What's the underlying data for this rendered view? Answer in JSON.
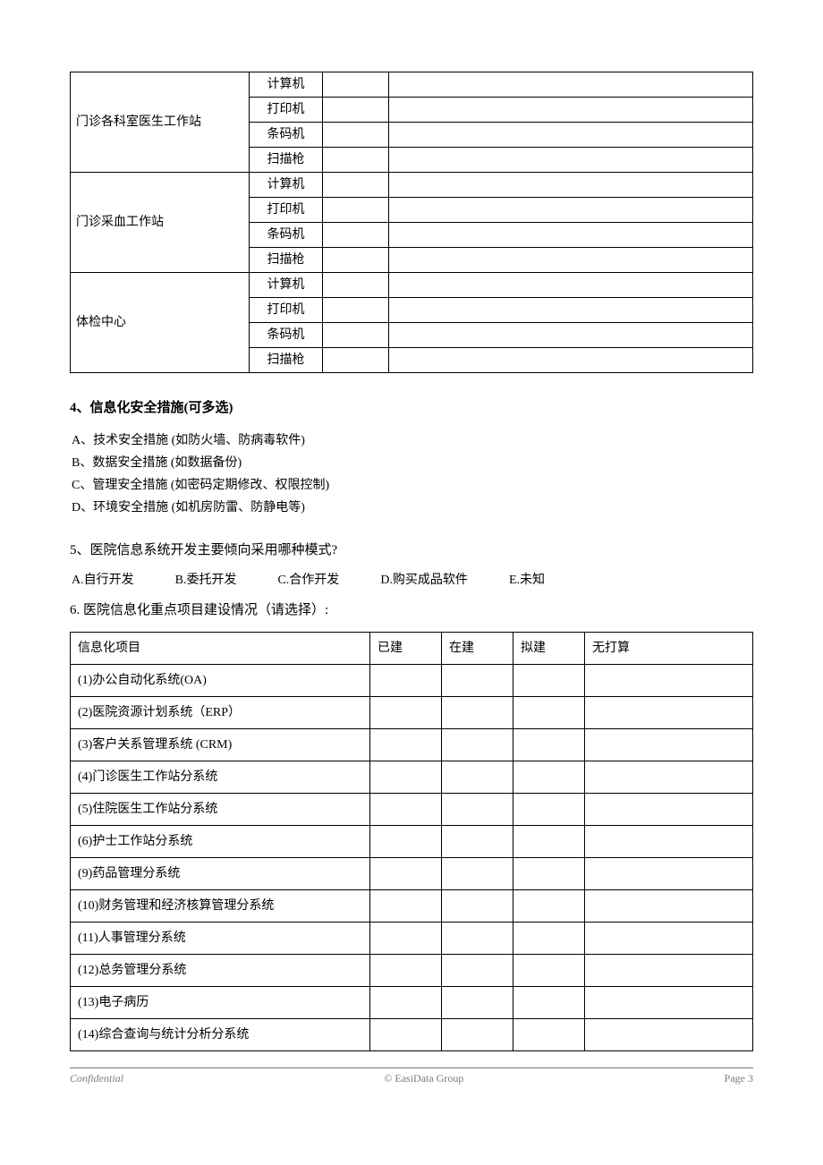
{
  "table1": {
    "groups": [
      {
        "label": "门诊各科室医生工作站",
        "rows": [
          "计算机",
          "打印机",
          "条码机",
          "扫描枪"
        ]
      },
      {
        "label": "门诊采血工作站",
        "rows": [
          "计算机",
          "打印机",
          "条码机",
          "扫描枪"
        ]
      },
      {
        "label": "体检中心",
        "rows": [
          "计算机",
          "打印机",
          "条码机",
          "扫描枪"
        ]
      }
    ]
  },
  "q4": {
    "heading": "4、信息化安全措施(可多选)",
    "options": [
      "A、技术安全措施 (如防火墙、防病毒软件)",
      "B、数据安全措施 (如数据备份)",
      "C、管理安全措施 (如密码定期修改、权限控制)",
      "D、环境安全措施 (如机房防雷、防静电等)"
    ]
  },
  "q5": {
    "heading": "5、医院信息系统开发主要倾向采用哪种模式?",
    "options": [
      "A.自行开发",
      "B.委托开发",
      "C.合作开发",
      "D.购买成品软件",
      "E.未知"
    ]
  },
  "q6": {
    "heading": "6. 医院信息化重点项目建设情况（请选择）:",
    "headers": [
      "信息化项目",
      "已建",
      "在建",
      "拟建",
      "无打算"
    ],
    "rows": [
      "(1)办公自动化系统(OA)",
      "(2)医院资源计划系统（ERP）",
      "(3)客户关系管理系统 (CRM)",
      "(4)门诊医生工作站分系统",
      "(5)住院医生工作站分系统",
      "(6)护士工作站分系统",
      "(9)药品管理分系统",
      "(10)财务管理和经济核算管理分系统",
      "(11)人事管理分系统",
      "(12)总务管理分系统",
      "(13)电子病历",
      "(14)综合查询与统计分析分系统"
    ]
  },
  "footer": {
    "left": "Confidential",
    "center": "© EasiData Group",
    "right": "Page  3"
  }
}
